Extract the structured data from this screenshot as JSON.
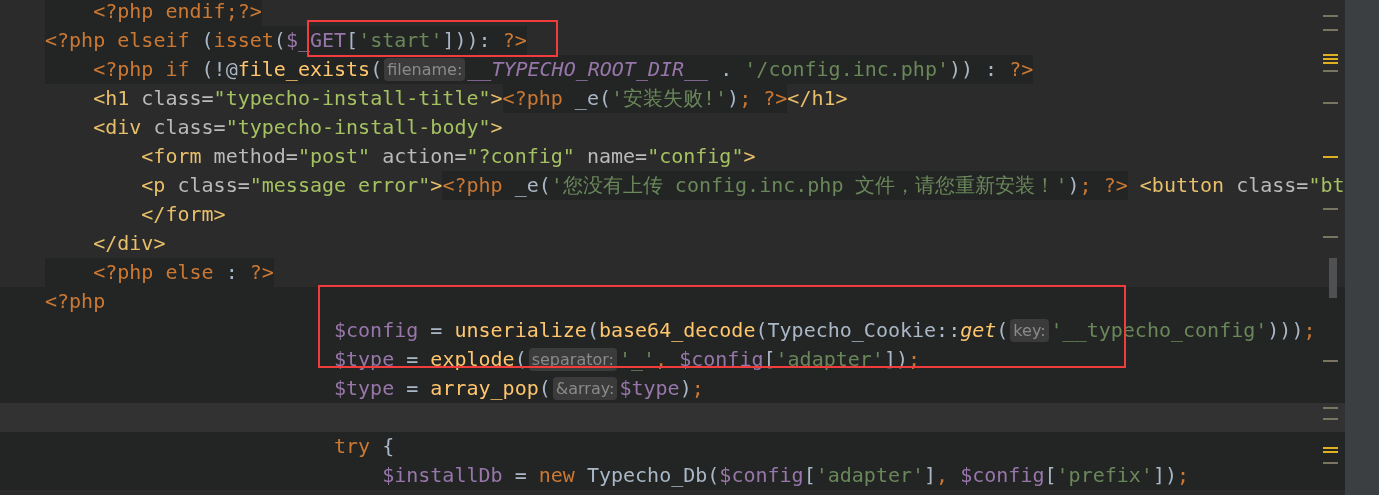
{
  "editor": {
    "lines": [
      {
        "segments": [
          {
            "embedded": true,
            "tokens": [
              {
                "kind": "php-tag",
                "text": "    <?php"
              },
              {
                "kind": "keyword",
                "text": " endif;"
              },
              {
                "kind": "php-tag",
                "text": "?>"
              }
            ]
          }
        ]
      },
      {
        "segments": [
          {
            "embedded": true,
            "tokens": [
              {
                "kind": "php-tag",
                "text": "<?php"
              },
              {
                "kind": "keyword",
                "text": " elseif "
              },
              {
                "kind": "punct",
                "text": "("
              },
              {
                "kind": "keyword",
                "text": "isset"
              },
              {
                "kind": "punct",
                "text": "("
              },
              {
                "kind": "var",
                "text": "$_GET"
              },
              {
                "kind": "punct",
                "text": "["
              },
              {
                "kind": "string",
                "text": "'start'"
              },
              {
                "kind": "punct",
                "text": "])): "
              },
              {
                "kind": "php-tag",
                "text": "?>"
              }
            ]
          }
        ]
      },
      {
        "segments": [
          {
            "embedded": true,
            "tokens": [
              {
                "kind": "php-tag",
                "text": "    <?php"
              },
              {
                "kind": "keyword",
                "text": " if "
              },
              {
                "kind": "punct",
                "text": "(!@"
              },
              {
                "kind": "func",
                "text": "file_exists"
              },
              {
                "kind": "punct",
                "text": "("
              },
              {
                "kind": "hint",
                "text": "filename:"
              },
              {
                "kind": "const",
                "text": "__TYPECHO_ROOT_DIR__"
              },
              {
                "kind": "punct",
                "text": " . "
              },
              {
                "kind": "string",
                "text": "'/config.inc.php'"
              },
              {
                "kind": "punct",
                "text": ")) : "
              },
              {
                "kind": "php-tag",
                "text": "?>"
              }
            ]
          }
        ]
      },
      {
        "segments": [
          {
            "tokens": [
              {
                "kind": "tag",
                "text": "    <h1"
              },
              {
                "kind": "attr",
                "text": " class="
              },
              {
                "kind": "attr-value",
                "text": "\"typecho-install-title\""
              },
              {
                "kind": "tag",
                "text": ">"
              }
            ]
          },
          {
            "embedded": true,
            "tokens": [
              {
                "kind": "php-tag",
                "text": "<?php"
              },
              {
                "kind": "punct",
                "text": " _e("
              },
              {
                "kind": "string",
                "text": "'安装失败!'"
              },
              {
                "kind": "punct",
                "text": ")"
              },
              {
                "kind": "keyword",
                "text": "; "
              },
              {
                "kind": "php-tag",
                "text": "?>"
              }
            ]
          },
          {
            "tokens": [
              {
                "kind": "tag",
                "text": "</h1>"
              }
            ]
          }
        ]
      },
      {
        "segments": [
          {
            "tokens": [
              {
                "kind": "tag",
                "text": "    <div"
              },
              {
                "kind": "attr",
                "text": " class="
              },
              {
                "kind": "attr-value",
                "text": "\"typecho-install-body\""
              },
              {
                "kind": "tag",
                "text": ">"
              }
            ]
          }
        ]
      },
      {
        "segments": [
          {
            "tokens": [
              {
                "kind": "tag",
                "text": "        <form"
              },
              {
                "kind": "attr",
                "text": " method="
              },
              {
                "kind": "attr-value",
                "text": "\"post\""
              },
              {
                "kind": "attr",
                "text": " action="
              },
              {
                "kind": "attr-value",
                "text": "\"?config\""
              },
              {
                "kind": "attr",
                "text": " name="
              },
              {
                "kind": "attr-value",
                "text": "\"config\""
              },
              {
                "kind": "tag",
                "text": ">"
              }
            ]
          }
        ]
      },
      {
        "segments": [
          {
            "tokens": [
              {
                "kind": "tag",
                "text": "        <p"
              },
              {
                "kind": "attr",
                "text": " class="
              },
              {
                "kind": "attr-value",
                "text": "\"message error\""
              },
              {
                "kind": "tag",
                "text": ">"
              }
            ]
          },
          {
            "embedded": true,
            "tokens": [
              {
                "kind": "php-tag",
                "text": "<?php"
              },
              {
                "kind": "punct",
                "text": " _e("
              },
              {
                "kind": "string",
                "text": "'您没有上传 config.inc.php 文件，请您重新安装！'"
              },
              {
                "kind": "punct",
                "text": ")"
              },
              {
                "kind": "keyword",
                "text": "; "
              },
              {
                "kind": "php-tag",
                "text": "?>"
              }
            ]
          },
          {
            "tokens": [
              {
                "kind": "tag",
                "text": " <button"
              },
              {
                "kind": "attr",
                "text": " class="
              },
              {
                "kind": "attr-value",
                "text": "\"bt"
              }
            ]
          }
        ]
      },
      {
        "segments": [
          {
            "tokens": [
              {
                "kind": "tag",
                "text": "        </form>"
              }
            ]
          }
        ]
      },
      {
        "segments": [
          {
            "tokens": [
              {
                "kind": "tag",
                "text": "    </div>"
              }
            ]
          }
        ]
      },
      {
        "segments": [
          {
            "embedded": true,
            "tokens": [
              {
                "kind": "php-tag",
                "text": "    <?php"
              },
              {
                "kind": "keyword",
                "text": " else "
              },
              {
                "kind": "punct",
                "text": ": "
              },
              {
                "kind": "php-tag",
                "text": "?>"
              }
            ]
          }
        ]
      }
    ],
    "php_block": {
      "lines": [
        {
          "segments": [
            {
              "tokens": [
                {
                  "kind": "php-tag",
                  "text": "<?php"
                }
              ]
            }
          ]
        },
        {
          "segments": [
            {
              "tokens": [
                {
                  "kind": "var",
                  "text": "                        $config"
                },
                {
                  "kind": "punct",
                  "text": " = "
                },
                {
                  "kind": "func",
                  "text": "unserialize"
                },
                {
                  "kind": "punct",
                  "text": "("
                },
                {
                  "kind": "func",
                  "text": "base64_decode"
                },
                {
                  "kind": "punct",
                  "text": "(Typecho_Cookie::"
                },
                {
                  "kind": "static-call",
                  "text": "get"
                },
                {
                  "kind": "punct",
                  "text": "("
                },
                {
                  "kind": "hint",
                  "text": "key:"
                },
                {
                  "kind": "string",
                  "text": "'__typecho_config'"
                },
                {
                  "kind": "punct",
                  "text": ")))"
                },
                {
                  "kind": "keyword",
                  "text": ";"
                }
              ]
            }
          ]
        },
        {
          "segments": [
            {
              "tokens": [
                {
                  "kind": "var",
                  "text": "                        $type"
                },
                {
                  "kind": "punct",
                  "text": " = "
                },
                {
                  "kind": "func",
                  "text": "explode"
                },
                {
                  "kind": "punct",
                  "text": "("
                },
                {
                  "kind": "hint",
                  "text": "separator:"
                },
                {
                  "kind": "string",
                  "text": "'_'"
                },
                {
                  "kind": "keyword",
                  "text": ", "
                },
                {
                  "kind": "var",
                  "text": "$config"
                },
                {
                  "kind": "punct",
                  "text": "["
                },
                {
                  "kind": "string",
                  "text": "'adapter'"
                },
                {
                  "kind": "punct",
                  "text": "])"
                },
                {
                  "kind": "keyword",
                  "text": ";"
                }
              ]
            }
          ]
        },
        {
          "segments": [
            {
              "tokens": [
                {
                  "kind": "var",
                  "text": "                        $type"
                },
                {
                  "kind": "punct",
                  "text": " = "
                },
                {
                  "kind": "func",
                  "text": "array_pop"
                },
                {
                  "kind": "punct",
                  "text": "("
                },
                {
                  "kind": "hint",
                  "text": "&array:"
                },
                {
                  "kind": "var",
                  "text": "$type"
                },
                {
                  "kind": "punct",
                  "text": ")"
                },
                {
                  "kind": "keyword",
                  "text": ";"
                }
              ]
            }
          ]
        },
        {
          "current": true
        },
        {
          "segments": [
            {
              "tokens": [
                {
                  "kind": "keyword",
                  "text": "                        try "
                },
                {
                  "kind": "punct",
                  "text": "{"
                }
              ]
            }
          ]
        },
        {
          "segments": [
            {
              "tokens": [
                {
                  "kind": "var",
                  "text": "                            $installDb"
                },
                {
                  "kind": "punct",
                  "text": " = "
                },
                {
                  "kind": "keyword",
                  "text": "new "
                },
                {
                  "kind": "punct",
                  "text": "Typecho_Db("
                },
                {
                  "kind": "var",
                  "text": "$config"
                },
                {
                  "kind": "punct",
                  "text": "["
                },
                {
                  "kind": "string",
                  "text": "'adapter'"
                },
                {
                  "kind": "punct",
                  "text": "]"
                },
                {
                  "kind": "keyword",
                  "text": ", "
                },
                {
                  "kind": "var",
                  "text": "$config"
                },
                {
                  "kind": "punct",
                  "text": "["
                },
                {
                  "kind": "string",
                  "text": "'prefix'"
                },
                {
                  "kind": "punct",
                  "text": "])"
                },
                {
                  "kind": "keyword",
                  "text": ";"
                }
              ]
            }
          ]
        }
      ]
    }
  }
}
